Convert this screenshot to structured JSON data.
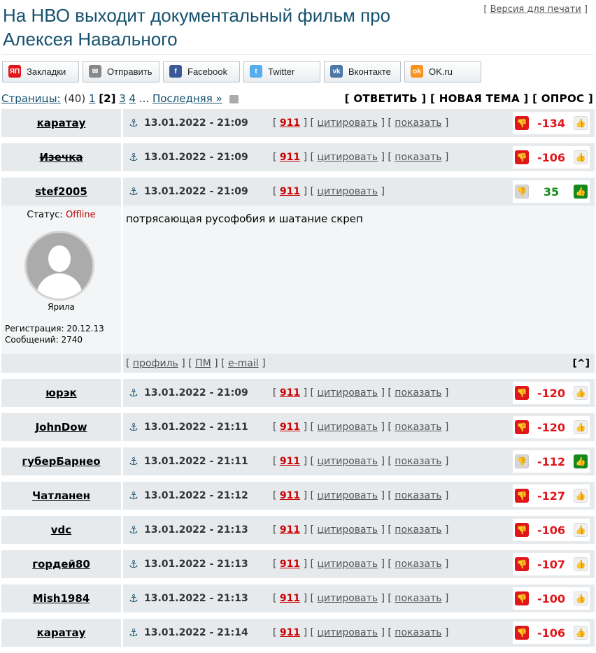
{
  "header": {
    "title": "На НВО выходит документальный фильм про Алексея Навального",
    "print_label": "Версия для печати"
  },
  "share": [
    {
      "label": "Закладки",
      "icon": "ya-icon",
      "icon_text": "ЯП",
      "color": "#e0161c"
    },
    {
      "label": "Отправить",
      "icon": "mail-icon",
      "icon_text": "✉",
      "color": "#888888"
    },
    {
      "label": "Facebook",
      "icon": "facebook-icon",
      "icon_text": "f",
      "color": "#3b5998"
    },
    {
      "label": "Twitter",
      "icon": "twitter-icon",
      "icon_text": "t",
      "color": "#55acee"
    },
    {
      "label": "Вконтакте",
      "icon": "vk-icon",
      "icon_text": "vk",
      "color": "#4a76a8"
    },
    {
      "label": "OK.ru",
      "icon": "ok-icon",
      "icon_text": "ok",
      "color": "#f7931e"
    }
  ],
  "pager": {
    "label": "Страницы:",
    "total": "(40)",
    "pages": [
      "1",
      "2",
      "3",
      "4"
    ],
    "current": "2",
    "ellipsis": "...",
    "last": "Последняя »"
  },
  "actions": {
    "reply": "[ ОТВЕТИТЬ ]",
    "new_topic": "[ НОВАЯ ТЕМА ]",
    "poll": "[ ОПРОС ]"
  },
  "labels": {
    "post_num": "911",
    "quote": "цитировать",
    "show": "показать"
  },
  "posts_before": [
    {
      "author": "каратау",
      "date": "13.01.2022 - 21:09",
      "score": "-134",
      "strike": false
    },
    {
      "author": "Изечка",
      "date": "13.01.2022 - 21:09",
      "score": "-106",
      "strike": true
    }
  ],
  "expanded_post": {
    "author": "stef2005",
    "date": "13.01.2022 - 21:09",
    "score": "35",
    "status_label": "Статус:",
    "status_value": "Offline",
    "nick": "Ярила",
    "registration": "Регистрация: 20.12.13",
    "messages": "Сообщений: 2740",
    "text": "потрясающая русофобия и шатание скреп",
    "profile": "профиль",
    "pm": "ПМ",
    "email": "e-mail",
    "top": "[^]"
  },
  "posts_after": [
    {
      "author": "юрэк",
      "date": "13.01.2022 - 21:09",
      "score": "-120"
    },
    {
      "author": "JohnDow",
      "date": "13.01.2022 - 21:11",
      "score": "-120"
    },
    {
      "author": "губерБарнео",
      "date": "13.01.2022 - 21:11",
      "score": "-112",
      "voted_up": true
    },
    {
      "author": "Чатланен",
      "date": "13.01.2022 - 21:12",
      "score": "-127"
    },
    {
      "author": "vdc",
      "date": "13.01.2022 - 21:13",
      "score": "-106"
    },
    {
      "author": "гордей80",
      "date": "13.01.2022 - 21:13",
      "score": "-107"
    },
    {
      "author": "Mish1984",
      "date": "13.01.2022 - 21:13",
      "score": "-100"
    },
    {
      "author": "каратау",
      "date": "13.01.2022 - 21:14",
      "score": "-106"
    }
  ]
}
